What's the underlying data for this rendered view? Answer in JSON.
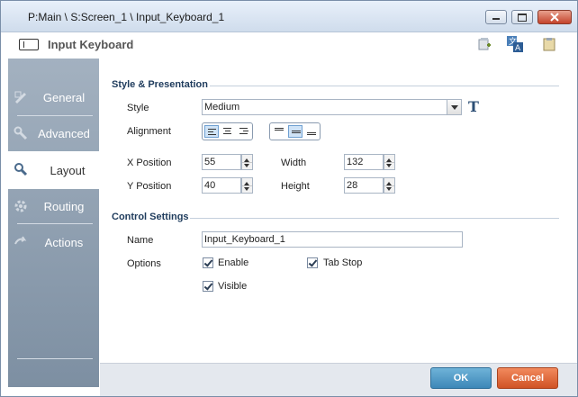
{
  "window": {
    "title": "P:Main \\ S:Screen_1 \\ Input_Keyboard_1"
  },
  "header": {
    "title": "Input Keyboard"
  },
  "sidebar": {
    "items": [
      {
        "label": "General",
        "icon": "general-icon"
      },
      {
        "label": "Advanced",
        "icon": "wrench-icon"
      },
      {
        "label": "Layout",
        "icon": "layout-icon",
        "selected": true
      },
      {
        "label": "Routing",
        "icon": "gear-icon"
      },
      {
        "label": "Actions",
        "icon": "actions-icon"
      }
    ]
  },
  "style_section": {
    "title": "Style & Presentation",
    "style_label": "Style",
    "style_value": "Medium",
    "text_tool_glyph": "T",
    "alignment_label": "Alignment",
    "x_label": "X Position",
    "x_value": "55",
    "y_label": "Y Position",
    "y_value": "40",
    "width_label": "Width",
    "width_value": "132",
    "height_label": "Height",
    "height_value": "28"
  },
  "control_section": {
    "title": "Control Settings",
    "name_label": "Name",
    "name_value": "Input_Keyboard_1",
    "options_label": "Options",
    "enable_label": "Enable",
    "tabstop_label": "Tab Stop",
    "visible_label": "Visible"
  },
  "footer": {
    "ok_label": "OK",
    "cancel_label": "Cancel"
  },
  "colors": {
    "ok": "#3d87b8",
    "cancel": "#d05325",
    "sidebar": "#8d9db0"
  }
}
